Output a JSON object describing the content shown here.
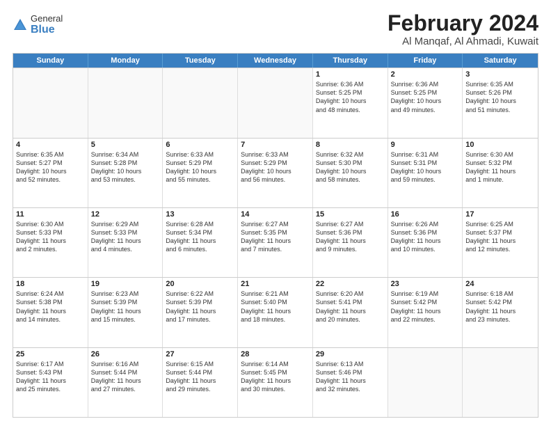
{
  "logo": {
    "general": "General",
    "blue": "Blue"
  },
  "title": "February 2024",
  "subtitle": "Al Manqaf, Al Ahmadi, Kuwait",
  "headers": [
    "Sunday",
    "Monday",
    "Tuesday",
    "Wednesday",
    "Thursday",
    "Friday",
    "Saturday"
  ],
  "rows": [
    [
      {
        "day": "",
        "lines": []
      },
      {
        "day": "",
        "lines": []
      },
      {
        "day": "",
        "lines": []
      },
      {
        "day": "",
        "lines": []
      },
      {
        "day": "1",
        "lines": [
          "Sunrise: 6:36 AM",
          "Sunset: 5:25 PM",
          "Daylight: 10 hours",
          "and 48 minutes."
        ]
      },
      {
        "day": "2",
        "lines": [
          "Sunrise: 6:36 AM",
          "Sunset: 5:25 PM",
          "Daylight: 10 hours",
          "and 49 minutes."
        ]
      },
      {
        "day": "3",
        "lines": [
          "Sunrise: 6:35 AM",
          "Sunset: 5:26 PM",
          "Daylight: 10 hours",
          "and 51 minutes."
        ]
      }
    ],
    [
      {
        "day": "4",
        "lines": [
          "Sunrise: 6:35 AM",
          "Sunset: 5:27 PM",
          "Daylight: 10 hours",
          "and 52 minutes."
        ]
      },
      {
        "day": "5",
        "lines": [
          "Sunrise: 6:34 AM",
          "Sunset: 5:28 PM",
          "Daylight: 10 hours",
          "and 53 minutes."
        ]
      },
      {
        "day": "6",
        "lines": [
          "Sunrise: 6:33 AM",
          "Sunset: 5:29 PM",
          "Daylight: 10 hours",
          "and 55 minutes."
        ]
      },
      {
        "day": "7",
        "lines": [
          "Sunrise: 6:33 AM",
          "Sunset: 5:29 PM",
          "Daylight: 10 hours",
          "and 56 minutes."
        ]
      },
      {
        "day": "8",
        "lines": [
          "Sunrise: 6:32 AM",
          "Sunset: 5:30 PM",
          "Daylight: 10 hours",
          "and 58 minutes."
        ]
      },
      {
        "day": "9",
        "lines": [
          "Sunrise: 6:31 AM",
          "Sunset: 5:31 PM",
          "Daylight: 10 hours",
          "and 59 minutes."
        ]
      },
      {
        "day": "10",
        "lines": [
          "Sunrise: 6:30 AM",
          "Sunset: 5:32 PM",
          "Daylight: 11 hours",
          "and 1 minute."
        ]
      }
    ],
    [
      {
        "day": "11",
        "lines": [
          "Sunrise: 6:30 AM",
          "Sunset: 5:33 PM",
          "Daylight: 11 hours",
          "and 2 minutes."
        ]
      },
      {
        "day": "12",
        "lines": [
          "Sunrise: 6:29 AM",
          "Sunset: 5:33 PM",
          "Daylight: 11 hours",
          "and 4 minutes."
        ]
      },
      {
        "day": "13",
        "lines": [
          "Sunrise: 6:28 AM",
          "Sunset: 5:34 PM",
          "Daylight: 11 hours",
          "and 6 minutes."
        ]
      },
      {
        "day": "14",
        "lines": [
          "Sunrise: 6:27 AM",
          "Sunset: 5:35 PM",
          "Daylight: 11 hours",
          "and 7 minutes."
        ]
      },
      {
        "day": "15",
        "lines": [
          "Sunrise: 6:27 AM",
          "Sunset: 5:36 PM",
          "Daylight: 11 hours",
          "and 9 minutes."
        ]
      },
      {
        "day": "16",
        "lines": [
          "Sunrise: 6:26 AM",
          "Sunset: 5:36 PM",
          "Daylight: 11 hours",
          "and 10 minutes."
        ]
      },
      {
        "day": "17",
        "lines": [
          "Sunrise: 6:25 AM",
          "Sunset: 5:37 PM",
          "Daylight: 11 hours",
          "and 12 minutes."
        ]
      }
    ],
    [
      {
        "day": "18",
        "lines": [
          "Sunrise: 6:24 AM",
          "Sunset: 5:38 PM",
          "Daylight: 11 hours",
          "and 14 minutes."
        ]
      },
      {
        "day": "19",
        "lines": [
          "Sunrise: 6:23 AM",
          "Sunset: 5:39 PM",
          "Daylight: 11 hours",
          "and 15 minutes."
        ]
      },
      {
        "day": "20",
        "lines": [
          "Sunrise: 6:22 AM",
          "Sunset: 5:39 PM",
          "Daylight: 11 hours",
          "and 17 minutes."
        ]
      },
      {
        "day": "21",
        "lines": [
          "Sunrise: 6:21 AM",
          "Sunset: 5:40 PM",
          "Daylight: 11 hours",
          "and 18 minutes."
        ]
      },
      {
        "day": "22",
        "lines": [
          "Sunrise: 6:20 AM",
          "Sunset: 5:41 PM",
          "Daylight: 11 hours",
          "and 20 minutes."
        ]
      },
      {
        "day": "23",
        "lines": [
          "Sunrise: 6:19 AM",
          "Sunset: 5:42 PM",
          "Daylight: 11 hours",
          "and 22 minutes."
        ]
      },
      {
        "day": "24",
        "lines": [
          "Sunrise: 6:18 AM",
          "Sunset: 5:42 PM",
          "Daylight: 11 hours",
          "and 23 minutes."
        ]
      }
    ],
    [
      {
        "day": "25",
        "lines": [
          "Sunrise: 6:17 AM",
          "Sunset: 5:43 PM",
          "Daylight: 11 hours",
          "and 25 minutes."
        ]
      },
      {
        "day": "26",
        "lines": [
          "Sunrise: 6:16 AM",
          "Sunset: 5:44 PM",
          "Daylight: 11 hours",
          "and 27 minutes."
        ]
      },
      {
        "day": "27",
        "lines": [
          "Sunrise: 6:15 AM",
          "Sunset: 5:44 PM",
          "Daylight: 11 hours",
          "and 29 minutes."
        ]
      },
      {
        "day": "28",
        "lines": [
          "Sunrise: 6:14 AM",
          "Sunset: 5:45 PM",
          "Daylight: 11 hours",
          "and 30 minutes."
        ]
      },
      {
        "day": "29",
        "lines": [
          "Sunrise: 6:13 AM",
          "Sunset: 5:46 PM",
          "Daylight: 11 hours",
          "and 32 minutes."
        ]
      },
      {
        "day": "",
        "lines": []
      },
      {
        "day": "",
        "lines": []
      }
    ]
  ]
}
